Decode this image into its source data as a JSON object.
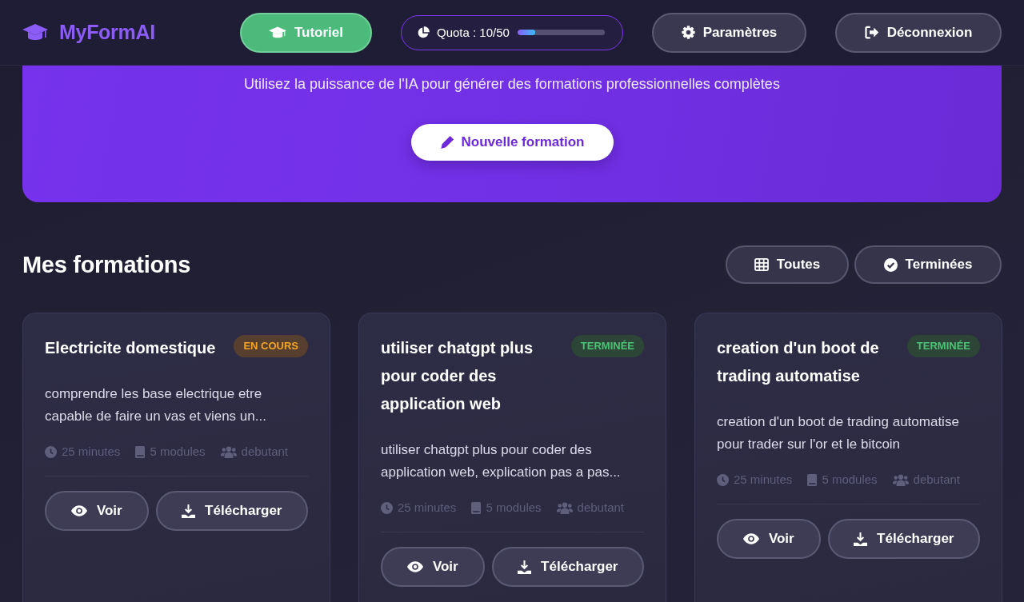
{
  "header": {
    "logo": {
      "text": "MyFormAI"
    },
    "nav": [
      {
        "kind": "tutorial",
        "label": "Tutoriel"
      },
      {
        "kind": "quota",
        "label": "Quota : 10/50",
        "level": 0.2
      },
      {
        "kind": "settings",
        "label": "Paramètres"
      },
      {
        "kind": "logout",
        "label": "Déconnexion"
      }
    ]
  },
  "hero": {
    "subtitle": "Utilisez la puissance de l'IA pour générer des formations professionnelles complètes",
    "button": {
      "label": "Nouvelle formation"
    }
  },
  "section": {
    "title": "Mes formations",
    "filters": [
      {
        "kind": "all",
        "label": "Toutes"
      },
      {
        "kind": "completed",
        "label": "Terminées"
      }
    ]
  },
  "courses": [
    {
      "title": "Electricite domestique",
      "badge": {
        "kind": "in_progress",
        "label": "EN COURS"
      },
      "description": "comprendre les base electrique etre capable de faire un vas et viens un...",
      "meta": [
        {
          "kind": "duration",
          "text": "25 minutes"
        },
        {
          "kind": "modules",
          "text": "5 modules"
        },
        {
          "kind": "difficulty",
          "text": "debutant"
        }
      ],
      "actions": [
        {
          "kind": "view",
          "label": "Voir"
        },
        {
          "kind": "download",
          "label": "Télécharger"
        }
      ]
    },
    {
      "title": "utiliser chatgpt plus pour coder des application web",
      "badge": {
        "kind": "done",
        "label": "TERMINÉE"
      },
      "description": "utiliser chatgpt plus pour coder des application web, explication pas a pas...",
      "meta": [
        {
          "kind": "duration",
          "text": "25 minutes"
        },
        {
          "kind": "modules",
          "text": "5 modules"
        },
        {
          "kind": "difficulty",
          "text": "debutant"
        }
      ],
      "actions": [
        {
          "kind": "view",
          "label": "Voir"
        },
        {
          "kind": "download",
          "label": "Télécharger"
        }
      ]
    },
    {
      "title": "creation d'un boot de trading automatise",
      "badge": {
        "kind": "done",
        "label": "TERMINÉE"
      },
      "description": "creation d'un boot de trading automatise pour trader sur l'or et le bitcoin",
      "meta": [
        {
          "kind": "duration",
          "text": "25 minutes"
        },
        {
          "kind": "modules",
          "text": "5 modules"
        },
        {
          "kind": "difficulty",
          "text": "debutant"
        }
      ],
      "actions": [
        {
          "kind": "view",
          "label": "Voir"
        },
        {
          "kind": "download",
          "label": "Télécharger"
        }
      ]
    }
  ]
}
